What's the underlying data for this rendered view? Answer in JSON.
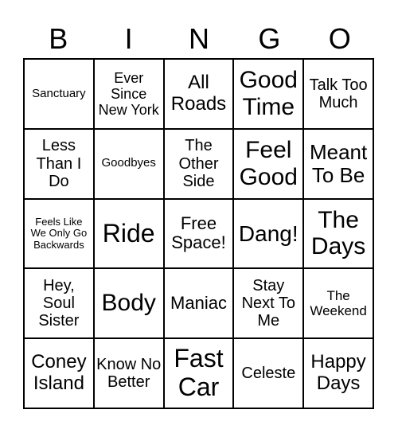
{
  "header": [
    "B",
    "I",
    "N",
    "G",
    "O"
  ],
  "cells": [
    "Sanctuary",
    "Ever Since New York",
    "All Roads",
    "Good Time",
    "Talk Too Much",
    "Less Than I Do",
    "Goodbyes",
    "The Other Side",
    "Feel Good",
    "Meant To Be",
    "Feels Like We Only Go Backwards",
    "Ride",
    "Free Space!",
    "Dang!",
    "The Days",
    "Hey, Soul Sister",
    "Body",
    "Maniac",
    "Stay Next To Me",
    "The Weekend",
    "Coney Island",
    "Know No Better",
    "Fast Car",
    "Celeste",
    "Happy Days"
  ]
}
